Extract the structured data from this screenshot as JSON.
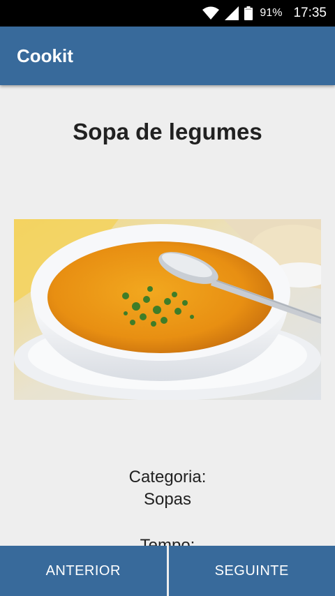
{
  "status_bar": {
    "battery_percent": "91%",
    "time": "17:35",
    "icons": [
      "wifi-icon",
      "cell-signal-icon",
      "battery-icon"
    ]
  },
  "app_bar": {
    "title": "Cookit",
    "color": "#386a9b"
  },
  "recipe": {
    "title": "Sopa de legumes",
    "image_subject": "bowl of orange vegetable soup with parsley and a spoon",
    "category_label": "Categoria:",
    "category_value": "Sopas",
    "time_label": "Tempo:"
  },
  "navigation": {
    "previous_label": "ANTERIOR",
    "next_label": "SEGUINTE"
  }
}
